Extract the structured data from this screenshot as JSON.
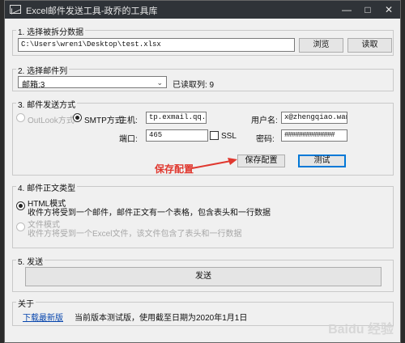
{
  "window": {
    "title": "Excel邮件发送工具-政乔的工具库"
  },
  "source": {
    "group_title": "1. 选择被拆分数据",
    "path": "C:\\Users\\wren1\\Desktop\\test.xlsx",
    "browse_label": "浏览",
    "read_label": "读取"
  },
  "column": {
    "group_title": "2. 选择邮件列",
    "selected": "邮箱:3",
    "read_info": "已读取列: 9"
  },
  "method": {
    "group_title": "3. 邮件发送方式",
    "outlook_label": "OutLook方式",
    "smtp_label": "SMTP方式",
    "host_label": "主机:",
    "host_value": "tp.exmail.qq.com",
    "port_label": "端口:",
    "port_value": "465",
    "ssl_label": "SSL",
    "user_label": "用户名:",
    "user_value": "x@zhengqiao.wang",
    "password_label": "密码:",
    "password_value": "##############",
    "save_label": "保存配置",
    "test_label": "测试",
    "annotation": "保存配置"
  },
  "body_type": {
    "group_title": "4. 邮件正文类型",
    "html_title": "HTML模式",
    "html_desc": "收件方将受到一个邮件，邮件正文有一个表格，包含表头和一行数据",
    "file_title": "文件模式",
    "file_desc": "收件方将受到一个Excel文件，该文件包含了表头和一行数据"
  },
  "send": {
    "group_title": "5. 发送",
    "send_label": "发送"
  },
  "about": {
    "group_title": "关于",
    "download_link": "下载最新版",
    "version_text": "当前版本测试版，使用截至日期为2020年1月1日"
  },
  "watermark": "Baidu 经验",
  "colors": {
    "titlebar": "#2f3338",
    "annotation": "#e0382f",
    "link": "#0645ad",
    "primary_border": "#0078d7"
  },
  "icons": {
    "app": "mail-icon",
    "minimize": "minimize-icon",
    "maximize": "maximize-icon",
    "close": "close-icon"
  }
}
